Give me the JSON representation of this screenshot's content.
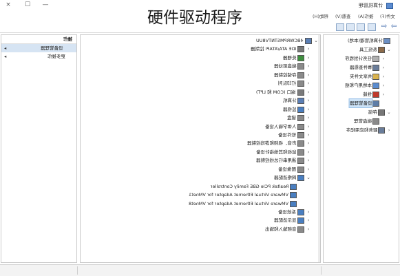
{
  "heading": "硬件驱动程序",
  "window": {
    "title": "计算机管理",
    "controls": [
      "×",
      "☐",
      "—"
    ]
  },
  "menu": [
    "文件(F)",
    "操作(A)",
    "查看(V)",
    "帮助(H)"
  ],
  "actions": {
    "header": "操作",
    "section": "设备管理器",
    "more": "更多操作"
  },
  "console_tree": [
    {
      "label": "计算机管理(本地)",
      "level": 0,
      "expander": "",
      "icon": "computer-management-icon",
      "color": "#6b8fc4"
    },
    {
      "label": "系统工具",
      "level": 1,
      "expander": "⌄",
      "icon": "tools-icon",
      "color": "#8c6b4a"
    },
    {
      "label": "任务计划程序",
      "level": 2,
      "expander": "›",
      "icon": "clock-icon",
      "color": "#b0b0b0"
    },
    {
      "label": "事件查看器",
      "level": 2,
      "expander": "›",
      "icon": "event-viewer-icon",
      "color": "#6a7d9a"
    },
    {
      "label": "共享文件夹",
      "level": 2,
      "expander": "›",
      "icon": "shared-folder-icon",
      "color": "#d9b24c"
    },
    {
      "label": "本地用户和组",
      "level": 2,
      "expander": "›",
      "icon": "users-icon",
      "color": "#5a8ccf"
    },
    {
      "label": "性能",
      "level": 2,
      "expander": "›",
      "icon": "performance-icon",
      "color": "#c0392b"
    },
    {
      "label": "设备管理器",
      "level": 2,
      "expander": "",
      "icon": "device-manager-icon",
      "color": "#5f7ea8",
      "selected": true
    },
    {
      "label": "存储",
      "level": 1,
      "expander": "⌄",
      "icon": "storage-icon",
      "color": "#777777"
    },
    {
      "label": "磁盘管理",
      "level": 2,
      "expander": "",
      "icon": "disk-icon",
      "color": "#8a8a8a"
    },
    {
      "label": "服务和应用程序",
      "level": 1,
      "expander": "›",
      "icon": "services-icon",
      "color": "#6a7d9a"
    }
  ],
  "device_tree": [
    {
      "label": "4BCWRPMSTNTV8UU",
      "level": 0,
      "expander": "⌄",
      "icon": "computer-icon",
      "color": "#5b7fb5"
    },
    {
      "label": "IDE ATA/ATAPI 控制器",
      "level": 1,
      "expander": "›",
      "icon": "ide-controller-icon",
      "color": "#7a7a7a"
    },
    {
      "label": "处理器",
      "level": 1,
      "expander": "›",
      "icon": "processor-icon",
      "color": "#3f8f3f"
    },
    {
      "label": "磁盘驱动器",
      "level": 1,
      "expander": "›",
      "icon": "disk-drive-icon",
      "color": "#8a8a8a"
    },
    {
      "label": "存储控制器",
      "level": 1,
      "expander": "›",
      "icon": "storage-controller-icon",
      "color": "#8a8a8a"
    },
    {
      "label": "打印队列",
      "level": 1,
      "expander": "›",
      "icon": "printer-icon",
      "color": "#8a8a8a"
    },
    {
      "label": "端口 (COM 和 LPT)",
      "level": 1,
      "expander": "›",
      "icon": "port-icon",
      "color": "#7a7a7a"
    },
    {
      "label": "计算机",
      "level": 1,
      "expander": "›",
      "icon": "computer-icon",
      "color": "#5b7fb5"
    },
    {
      "label": "监视器",
      "level": 1,
      "expander": "›",
      "icon": "monitor-icon",
      "color": "#4a7fc1"
    },
    {
      "label": "键盘",
      "level": 1,
      "expander": "›",
      "icon": "keyboard-icon",
      "color": "#8a8a8a"
    },
    {
      "label": "人体学输入设备",
      "level": 1,
      "expander": "›",
      "icon": "hid-icon",
      "color": "#8a8a8a"
    },
    {
      "label": "软件设备",
      "level": 1,
      "expander": "›",
      "icon": "software-device-icon",
      "color": "#8a8a8a"
    },
    {
      "label": "声音、视频和游戏控制器",
      "level": 1,
      "expander": "›",
      "icon": "sound-icon",
      "color": "#8a8a8a"
    },
    {
      "label": "鼠标和其他指针设备",
      "level": 1,
      "expander": "›",
      "icon": "mouse-icon",
      "color": "#8a8a8a"
    },
    {
      "label": "通用串行总线控制器",
      "level": 1,
      "expander": "›",
      "icon": "usb-icon",
      "color": "#8a8a8a"
    },
    {
      "label": "图像设备",
      "level": 1,
      "expander": "›",
      "icon": "camera-icon",
      "color": "#8a8a8a"
    },
    {
      "label": "网络适配器",
      "level": 1,
      "expander": "⌄",
      "icon": "network-adapter-icon",
      "color": "#4a7fc1"
    },
    {
      "label": "Realtek PCIe GBE Family Controller",
      "level": 2,
      "expander": "",
      "icon": "network-card-icon",
      "color": "#4a7fc1"
    },
    {
      "label": "VMware Virtual Ethernet Adapter for VMnet1",
      "level": 2,
      "expander": "",
      "icon": "network-card-icon",
      "color": "#4a7fc1"
    },
    {
      "label": "VMware Virtual Ethernet Adapter for VMnet8",
      "level": 2,
      "expander": "",
      "icon": "network-card-icon",
      "color": "#4a7fc1"
    },
    {
      "label": "系统设备",
      "level": 1,
      "expander": "›",
      "icon": "system-device-icon",
      "color": "#4a7fc1"
    },
    {
      "label": "显示适配器",
      "level": 1,
      "expander": "›",
      "icon": "display-adapter-icon",
      "color": "#4a7fc1"
    },
    {
      "label": "音频输入和输出",
      "level": 1,
      "expander": "›",
      "icon": "audio-icon",
      "color": "#8a8a8a"
    }
  ]
}
